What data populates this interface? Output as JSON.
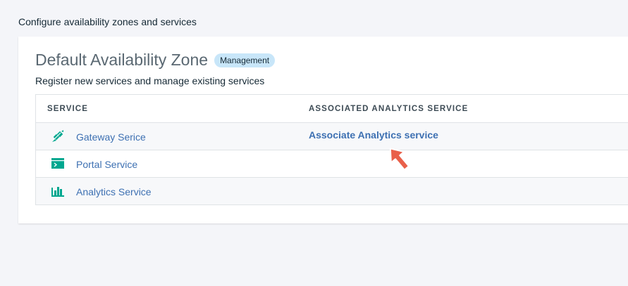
{
  "page": {
    "heading": "Configure availability zones and services"
  },
  "zone": {
    "title": "Default Availability Zone",
    "badge": "Management",
    "subtitle": "Register new services and manage existing services"
  },
  "table": {
    "columns": [
      "SERVICE",
      "ASSOCIATED ANALYTICS SERVICE"
    ],
    "rows": [
      {
        "icon": "gateway-icon",
        "name": "Gateway Serice",
        "associated": "Associate Analytics service"
      },
      {
        "icon": "portal-icon",
        "name": "Portal Service",
        "associated": ""
      },
      {
        "icon": "analytics-icon",
        "name": "Analytics Service",
        "associated": ""
      }
    ]
  },
  "colors": {
    "accent": "#3d70b2",
    "icon": "#00a78f",
    "badge_bg": "#c8e6f9",
    "pointer": "#e9604a"
  }
}
